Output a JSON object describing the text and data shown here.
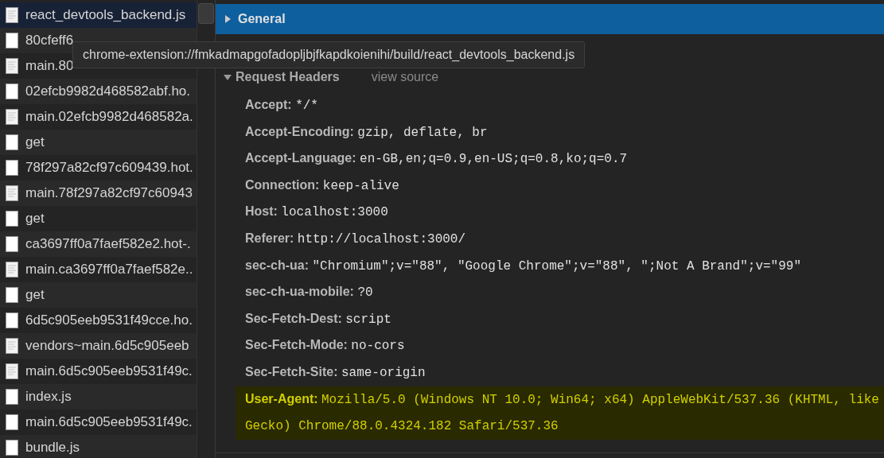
{
  "requests": [
    {
      "name": "react_devtools_backend.js",
      "kind": "script",
      "selected": true
    },
    {
      "name": "80cfeff6",
      "kind": "document",
      "selected": false
    },
    {
      "name": "main.80",
      "kind": "script",
      "selected": false
    },
    {
      "name": "02efcb9982d468582abf.ho.",
      "kind": "document",
      "selected": false
    },
    {
      "name": "main.02efcb9982d468582a.",
      "kind": "script",
      "selected": false
    },
    {
      "name": "get",
      "kind": "document",
      "selected": false
    },
    {
      "name": "78f297a82cf97c609439.hot.",
      "kind": "document",
      "selected": false
    },
    {
      "name": "main.78f297a82cf97c60943",
      "kind": "script",
      "selected": false
    },
    {
      "name": "get",
      "kind": "document",
      "selected": false
    },
    {
      "name": "ca3697ff0a7faef582e2.hot-.",
      "kind": "document",
      "selected": false
    },
    {
      "name": "main.ca3697ff0a7faef582e..",
      "kind": "script",
      "selected": false
    },
    {
      "name": "get",
      "kind": "document",
      "selected": false
    },
    {
      "name": "6d5c905eeb9531f49cce.ho.",
      "kind": "document",
      "selected": false
    },
    {
      "name": "vendors~main.6d5c905eeb",
      "kind": "script",
      "selected": false
    },
    {
      "name": "main.6d5c905eeb9531f49c.",
      "kind": "script",
      "selected": false
    },
    {
      "name": "index.js",
      "kind": "document",
      "selected": false
    },
    {
      "name": "main.6d5c905eeb9531f49c.",
      "kind": "document",
      "selected": false
    },
    {
      "name": "bundle.js",
      "kind": "document",
      "selected": false
    }
  ],
  "general": {
    "title": "General",
    "expanded": false
  },
  "tooltip": "chrome-extension://fmkadmapgofadopljbjfkapdkoienihi/build/react_devtools_backend.js",
  "request_headers": {
    "title": "Request Headers",
    "expanded": true,
    "link": "view source",
    "headers": [
      {
        "name": "Accept:",
        "value": "*/*",
        "highlighted": false
      },
      {
        "name": "Accept-Encoding:",
        "value": "gzip, deflate, br",
        "highlighted": false
      },
      {
        "name": "Accept-Language:",
        "value": "en-GB,en;q=0.9,en-US;q=0.8,ko;q=0.7",
        "highlighted": false
      },
      {
        "name": "Connection:",
        "value": "keep-alive",
        "highlighted": false
      },
      {
        "name": "Host:",
        "value": "localhost:3000",
        "highlighted": false
      },
      {
        "name": "Referer:",
        "value": "http://localhost:3000/",
        "highlighted": false
      },
      {
        "name": "sec-ch-ua:",
        "value": "\"Chromium\";v=\"88\", \"Google Chrome\";v=\"88\", \";Not A Brand\";v=\"99\"",
        "highlighted": false
      },
      {
        "name": "sec-ch-ua-mobile:",
        "value": "?0",
        "highlighted": false
      },
      {
        "name": "Sec-Fetch-Dest:",
        "value": "script",
        "highlighted": false
      },
      {
        "name": "Sec-Fetch-Mode:",
        "value": "no-cors",
        "highlighted": false
      },
      {
        "name": "Sec-Fetch-Site:",
        "value": "same-origin",
        "highlighted": false
      },
      {
        "name": "User-Agent:",
        "value": "Mozilla/5.0 (Windows NT 10.0; Win64; x64) AppleWebKit/537.36 (KHTML, like Gecko) Chrome/88.0.4324.182 Safari/537.36",
        "highlighted": true
      }
    ]
  }
}
